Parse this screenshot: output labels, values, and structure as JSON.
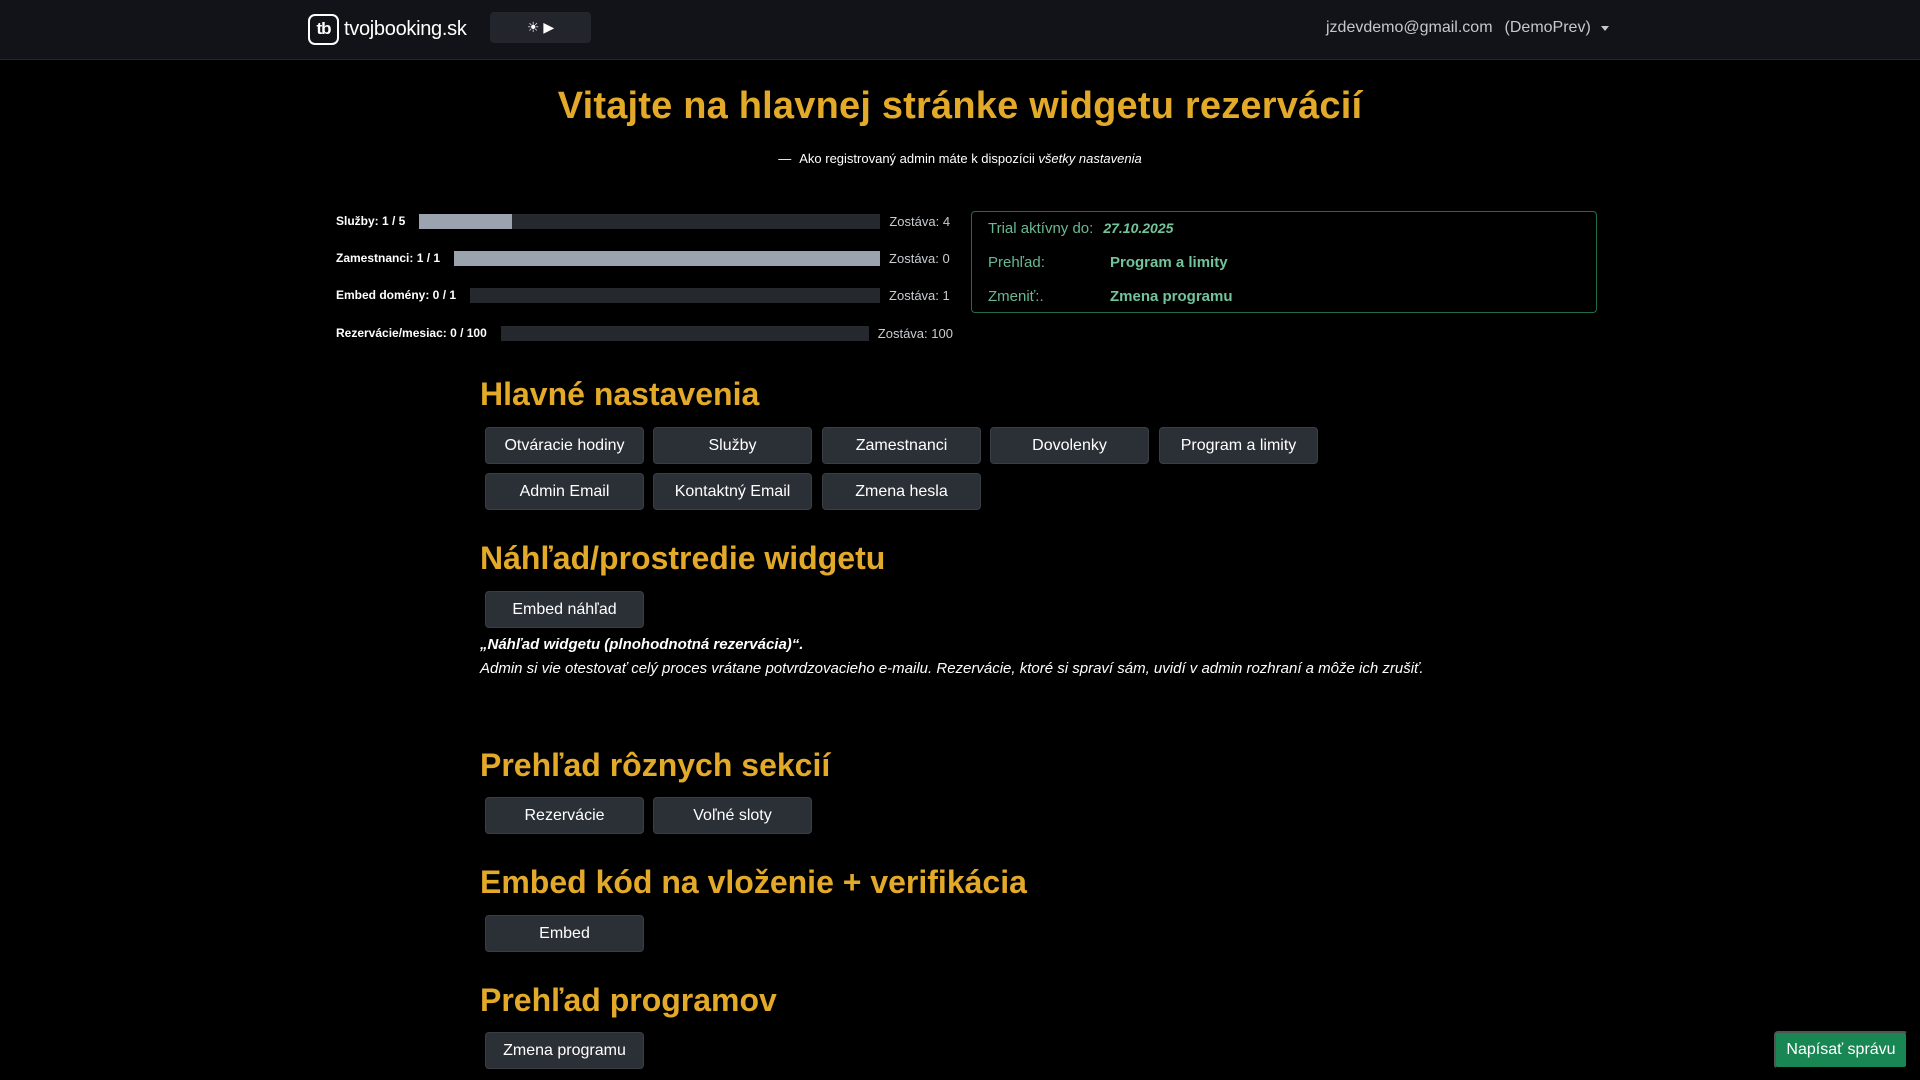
{
  "navbar": {
    "logo_text": "tb",
    "brand": "tvojbooking.sk",
    "theme_toggle": "☀ ▶",
    "user_email": "jzdevdemo@gmail.com",
    "user_role": "(DemoPrev)"
  },
  "hero": {
    "title": "Vitajte na hlavnej stránke widgetu rezervácií",
    "subtitle_dash": "—",
    "subtitle": "Ako registrovaný admin máte k dispozícii",
    "subtitle_em": "všetky nastavenia"
  },
  "usage": [
    {
      "label": "Služby: 1 / 5",
      "fraction": 0.2,
      "remaining": "Zostáva: 4"
    },
    {
      "label": "Zamestnanci: 1 / 1",
      "fraction": 1.0,
      "remaining": "Zostáva: 0"
    },
    {
      "label": "Embed domény: 0 / 1",
      "fraction": 0.0,
      "remaining": "Zostáva: 1"
    },
    {
      "label": "Rezervácie/mesiac: 0 / 100",
      "fraction": 0.0,
      "remaining": "Zostáva: 100"
    }
  ],
  "trial": {
    "active_label": "Trial aktívny do:",
    "active_value": "27.10.2025",
    "overview_label": "Prehľad:",
    "overview_link": "Program a limity",
    "change_label": "Zmeniť:.",
    "change_link": "Zmena programu"
  },
  "sections": {
    "main": {
      "title": "Hlavné nastavenia",
      "buttons": [
        "Otváracie hodiny",
        "Služby",
        "Zamestnanci",
        "Dovolenky",
        "Program a limity",
        "Admin Email",
        "Kontaktný Email",
        "Zmena hesla"
      ]
    },
    "preview": {
      "title": "Náhľad/prostredie widgetu",
      "button": "Embed náhľad",
      "desc_title": "„Náhľad widgetu (plnohodnotná rezervácia)“.",
      "desc_body": "Admin si vie otestovať celý proces vrátane potvrdzovacieho e-mailu. Rezervácie, ktoré si spraví sám, uvidí v admin rozhraní a môže ich zrušiť."
    },
    "overview": {
      "title": "Prehľad rôznych sekcií",
      "buttons": [
        "Rezervácie",
        "Voľné sloty"
      ]
    },
    "embed": {
      "title": "Embed kód na vloženie + verifikácia",
      "button": "Embed"
    },
    "programs": {
      "title": "Prehľad programov",
      "button": "Zmena programu"
    }
  },
  "chat_button": "Napísať správu"
}
